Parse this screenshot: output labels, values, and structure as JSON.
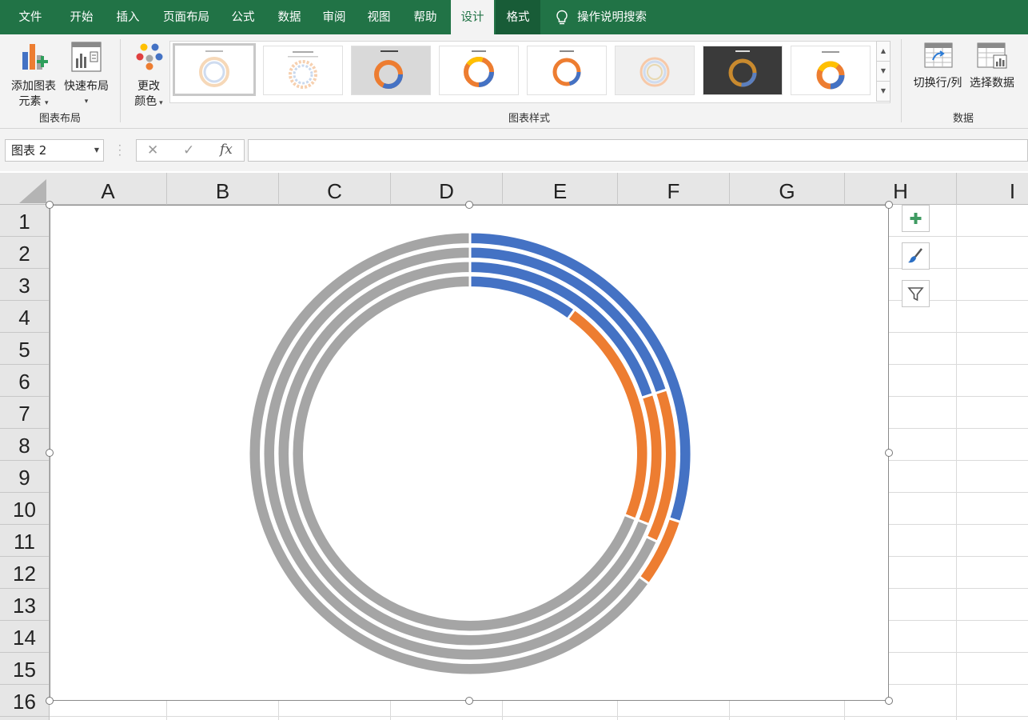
{
  "tabs": [
    "文件",
    "开始",
    "插入",
    "页面布局",
    "公式",
    "数据",
    "审阅",
    "视图",
    "帮助",
    "设计",
    "格式"
  ],
  "active_tab": "设计",
  "tell_me": "操作说明搜索",
  "ribbon": {
    "add_chart_element": {
      "line1": "添加图表",
      "line2": "元素"
    },
    "quick_layout": "快速布局",
    "group_chart_layout": "图表布局",
    "change_colors": {
      "line1": "更改",
      "line2": "颜色"
    },
    "group_chart_styles": "图表样式",
    "switch_row_col": "切换行/列",
    "select_data": "选择数据",
    "group_data": "数据"
  },
  "formula_bar": {
    "name_box": "图表 2",
    "cancel_icon": "✕",
    "enter_icon": "✓",
    "fx": "fx",
    "formula": ""
  },
  "columns": [
    "A",
    "B",
    "C",
    "D",
    "E",
    "F",
    "G",
    "H",
    "I"
  ],
  "rows": [
    "1",
    "2",
    "3",
    "4",
    "5",
    "6",
    "7",
    "8",
    "9",
    "10",
    "11",
    "12",
    "13",
    "14",
    "15",
    "16"
  ],
  "colors": {
    "accent": "#217346",
    "blue": "#4472c4",
    "orange": "#ed7d31",
    "gray": "#a5a5a5"
  },
  "chart_data": {
    "type": "doughnut",
    "rings": [
      {
        "ring": "outer",
        "values": [
          30,
          5,
          65
        ]
      },
      {
        "ring": "second",
        "values": [
          20,
          12,
          68
        ]
      },
      {
        "ring": "third",
        "values": [
          20,
          11,
          69
        ]
      },
      {
        "ring": "inner",
        "values": [
          10,
          21,
          69
        ]
      }
    ],
    "series_colors": [
      "#4472c4",
      "#ed7d31",
      "#a5a5a5"
    ]
  },
  "chart_tools": [
    "plus-icon",
    "brush-icon",
    "filter-icon"
  ]
}
